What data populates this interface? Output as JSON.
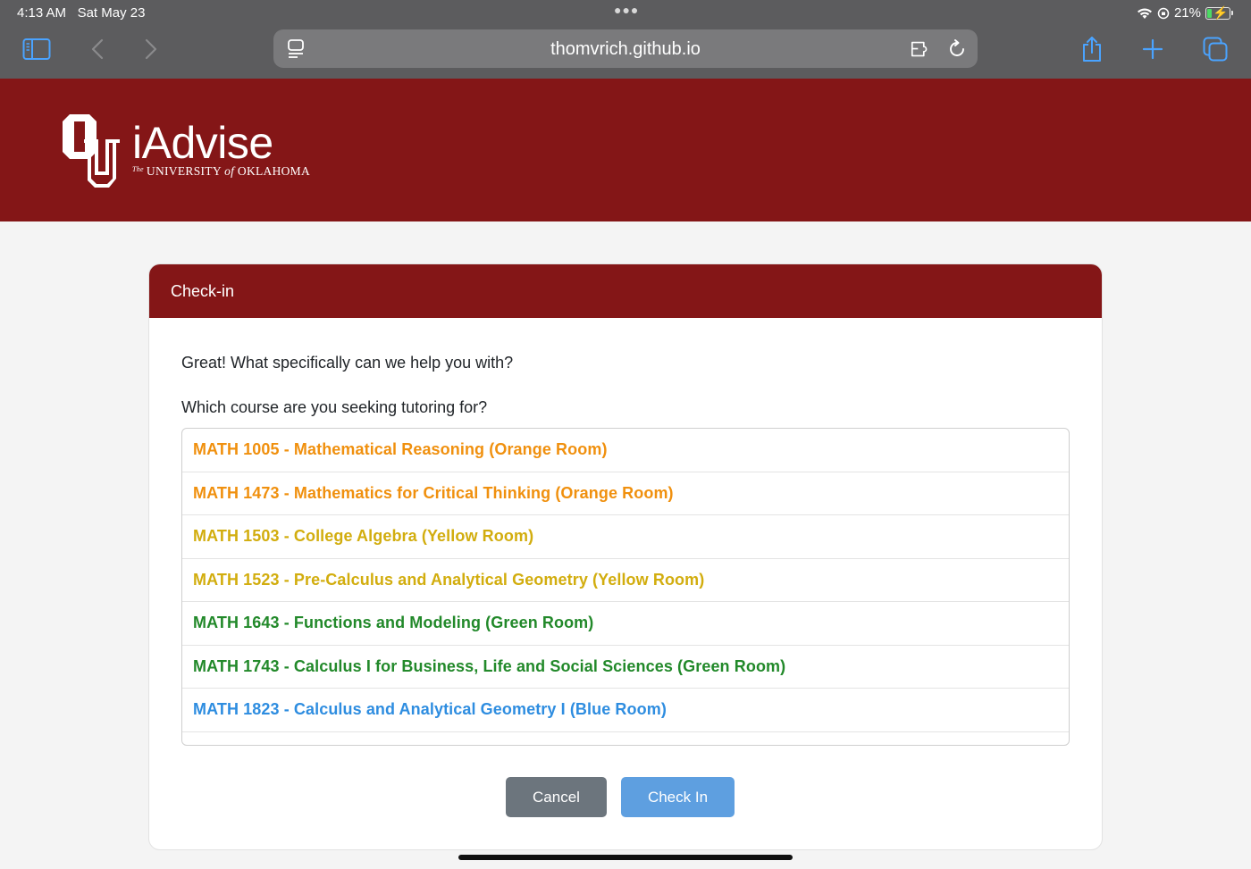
{
  "status_bar": {
    "time": "4:13 AM",
    "date": "Sat May 23",
    "battery_percent": "21%",
    "battery_level": 0.21
  },
  "browser": {
    "url": "thomvrich.github.io",
    "icons": [
      "sidebar-icon",
      "back-icon",
      "forward-icon",
      "reader-icon",
      "extension-icon",
      "reload-icon",
      "share-icon",
      "new-tab-icon",
      "tabs-icon"
    ]
  },
  "header": {
    "brand_title": "iAdvise",
    "brand_sub_the": "The",
    "brand_sub_university": "UNIVERSITY",
    "brand_sub_of": "of",
    "brand_sub_state": "OKLAHOMA",
    "bg_color": "#841617"
  },
  "card": {
    "title": "Check-in",
    "prompt_1": "Great! What specifically can we help you with?",
    "prompt_2": "Which course are you seeking tutoring for?",
    "courses": [
      {
        "label": "MATH 1005 - Mathematical Reasoning (Orange Room)",
        "color": "#f0900e"
      },
      {
        "label": "MATH 1473 - Mathematics for Critical Thinking (Orange Room)",
        "color": "#f0900e"
      },
      {
        "label": "MATH 1503 - College Algebra (Yellow Room)",
        "color": "#d2ad0e"
      },
      {
        "label": "MATH 1523 - Pre-Calculus and Analytical Geometry (Yellow Room)",
        "color": "#d2ad0e"
      },
      {
        "label": "MATH 1643 - Functions and Modeling (Green Room)",
        "color": "#22892a"
      },
      {
        "label": "MATH 1743 - Calculus I for Business, Life and Social Sciences (Green Room)",
        "color": "#22892a"
      },
      {
        "label": "MATH 1823 - Calculus and Analytical Geometry I (Blue Room)",
        "color": "#2e8de0"
      }
    ],
    "cancel_label": "Cancel",
    "checkin_label": "Check In"
  }
}
